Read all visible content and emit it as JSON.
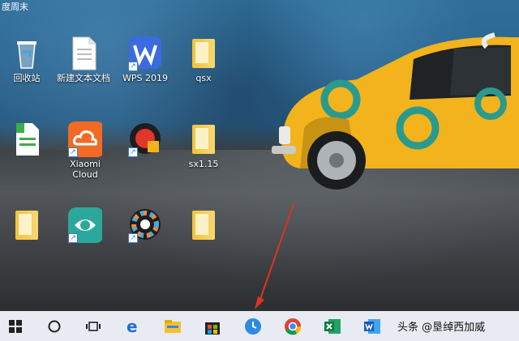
{
  "top_text": "度周末",
  "desktop_icons": [
    {
      "label": "回收站",
      "type": "recycle"
    },
    {
      "label": "新建文本文档",
      "type": "doc"
    },
    {
      "label": "WPS 2019",
      "type": "wps"
    },
    {
      "label": "qsx",
      "type": "folder"
    },
    {
      "label": "",
      "type": "sheet"
    },
    {
      "label": "Xiaomi Cloud",
      "type": "xiaomi"
    },
    {
      "label": "",
      "type": "app-red"
    },
    {
      "label": "sx1.15",
      "type": "folder"
    },
    {
      "label": "",
      "type": "folder2"
    },
    {
      "label": "",
      "type": "green-app"
    },
    {
      "label": "",
      "type": "color-wheel"
    },
    {
      "label": "",
      "type": "folder"
    }
  ],
  "taskbar": {
    "icons": [
      "windows-start-icon",
      "search-circle-icon",
      "task-view-icon",
      "edge-icon",
      "file-explorer-icon",
      "store-icon",
      "clock-app-icon",
      "chrome-icon",
      "excel-icon",
      "word-icon"
    ]
  },
  "watermark": "头条 @垦绰西加威"
}
